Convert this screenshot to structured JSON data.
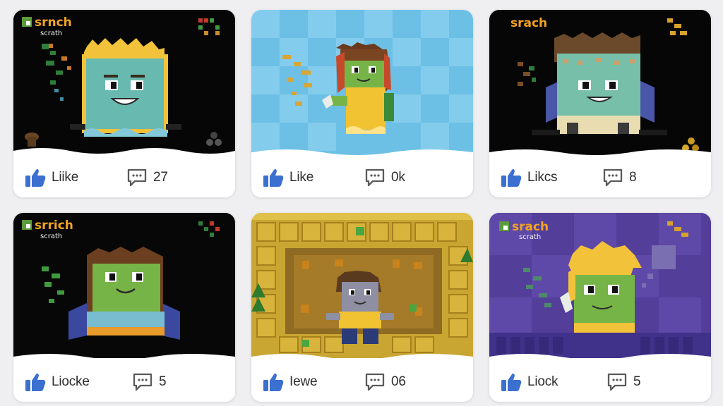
{
  "cards": [
    {
      "likes_label": "Liike",
      "comments_label": "27",
      "wm_title": "srnch",
      "wm_sub": "scrath"
    },
    {
      "likes_label": "Like",
      "comments_label": "0k"
    },
    {
      "likes_label": "Likcs",
      "comments_label": "8",
      "wm_title": "srach"
    },
    {
      "likes_label": "Liocke",
      "comments_label": "5",
      "wm_title": "srrich",
      "wm_sub": "scrath"
    },
    {
      "likes_label": "Iewe",
      "comments_label": "06"
    },
    {
      "likes_label": "Liock",
      "comments_label": "5",
      "wm_title": "srach",
      "wm_sub": "scrath"
    }
  ],
  "colors": {
    "like_blue": "#3b6fd0",
    "comment_gray": "#5a5a5a"
  },
  "icons": {
    "like": "thumbs-up-icon",
    "comment": "comment-bubble-icon"
  }
}
